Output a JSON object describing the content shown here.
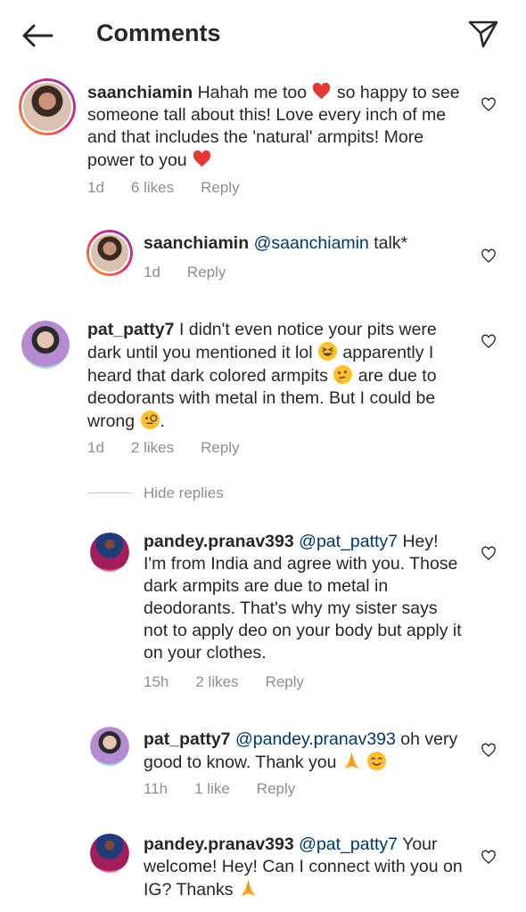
{
  "header": {
    "title": "Comments",
    "back_icon": "arrow-left-icon",
    "send_icon": "paper-plane-icon"
  },
  "comments": [
    {
      "user": "saanchiamin",
      "text_parts": [
        "Hahah me too ",
        " so happy to see someone tall about this! Love every inch of me and that includes the 'natural' armpits! More power to you "
      ],
      "time": "1d",
      "likes": "6 likes",
      "reply": "Reply"
    },
    {
      "user": "saanchiamin",
      "mention": "@saanchiamin",
      "text": " talk*",
      "time": "1d",
      "reply": "Reply"
    },
    {
      "user": "pat_patty7",
      "text_parts": [
        "I didn't even notice your pits were dark until you mentioned it lol ",
        " apparently I heard that dark colored armpits ",
        " are due to deodorants with metal in them. But I could be wrong ",
        "."
      ],
      "time": "1d",
      "likes": "2 likes",
      "reply": "Reply"
    },
    {
      "user": "pandey.pranav393",
      "mention": "@pat_patty7",
      "text": " Hey! I'm from India and agree with you. Those dark armpits are due to metal in deodorants. That's why my sister says not to apply deo on your body but apply it on your clothes.",
      "time": "15h",
      "likes": "2 likes",
      "reply": "Reply"
    },
    {
      "user": "pat_patty7",
      "mention": "@pandey.pranav393",
      "text": " oh very good to know. Thank you ",
      "time": "11h",
      "likes": "1 like",
      "reply": "Reply"
    },
    {
      "user": "pandey.pranav393",
      "mention": "@pat_patty7",
      "text": " Your welcome! Hey! Can I connect with you on IG? Thanks "
    }
  ],
  "hide_replies": "Hide replies",
  "colors": {
    "text": "#262626",
    "meta": "#8e8e8e",
    "mention": "#00376b",
    "heart_red": "#e53935"
  }
}
